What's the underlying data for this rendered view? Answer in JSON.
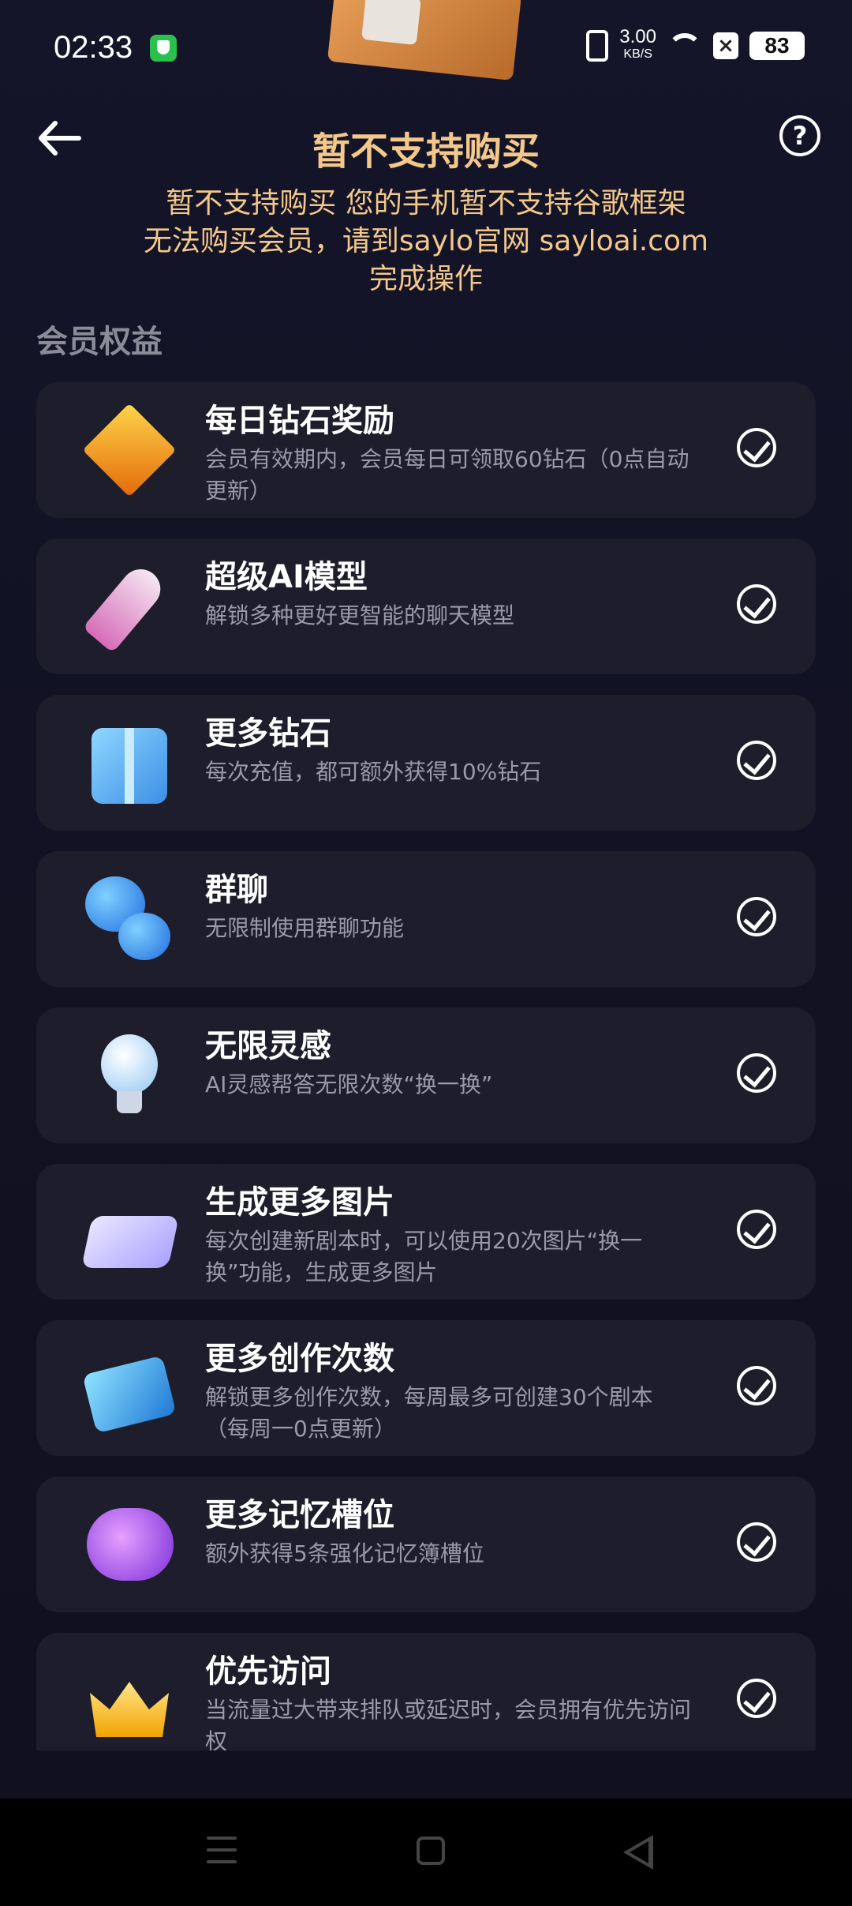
{
  "status_bar": {
    "time": "02:33",
    "net_speed_value": "3.00",
    "net_speed_unit": "KB/S",
    "battery": "83"
  },
  "header": {
    "title": "暂不支持购买",
    "notice_lines": [
      "暂不支持购买  您的手机暂不支持谷歌框架",
      "无法购买会员，请到saylo官网 sayloai.com",
      "完成操作"
    ]
  },
  "section_title": "会员权益",
  "benefits": [
    {
      "title": "每日钻石奖励",
      "desc": "会员有效期内，会员每日可领取60钻石（0点自动更新）",
      "icon": "diamond-icon"
    },
    {
      "title": "超级AI模型",
      "desc": "解锁多种更好更智能的聊天模型",
      "icon": "rocket-icon"
    },
    {
      "title": "更多钻石",
      "desc": "每次充值，都可额外获得10%钻石",
      "icon": "gift-box-icon"
    },
    {
      "title": "群聊",
      "desc": "无限制使用群聊功能",
      "icon": "chat-bubbles-icon"
    },
    {
      "title": "无限灵感",
      "desc": "AI灵感帮答无限次数“换一换”",
      "icon": "lightbulb-icon"
    },
    {
      "title": "生成更多图片",
      "desc": "每次创建新剧本时，可以使用20次图片“换一换”功能，生成更多图片",
      "icon": "palette-icon"
    },
    {
      "title": "更多创作次数",
      "desc": "解锁更多创作次数，每周最多可创建30个剧本（每周一0点更新）",
      "icon": "book-icon"
    },
    {
      "title": "更多记忆槽位",
      "desc": "额外获得5条强化记忆簿槽位",
      "icon": "brain-icon"
    },
    {
      "title": "优先访问",
      "desc": "当流量过大带来排队或延迟时，会员拥有优先访问权",
      "icon": "crown-icon"
    }
  ],
  "colors": {
    "accent_gold": "#f3c889",
    "card_bg": "#1d1d2c",
    "page_bg": "#13132a"
  }
}
